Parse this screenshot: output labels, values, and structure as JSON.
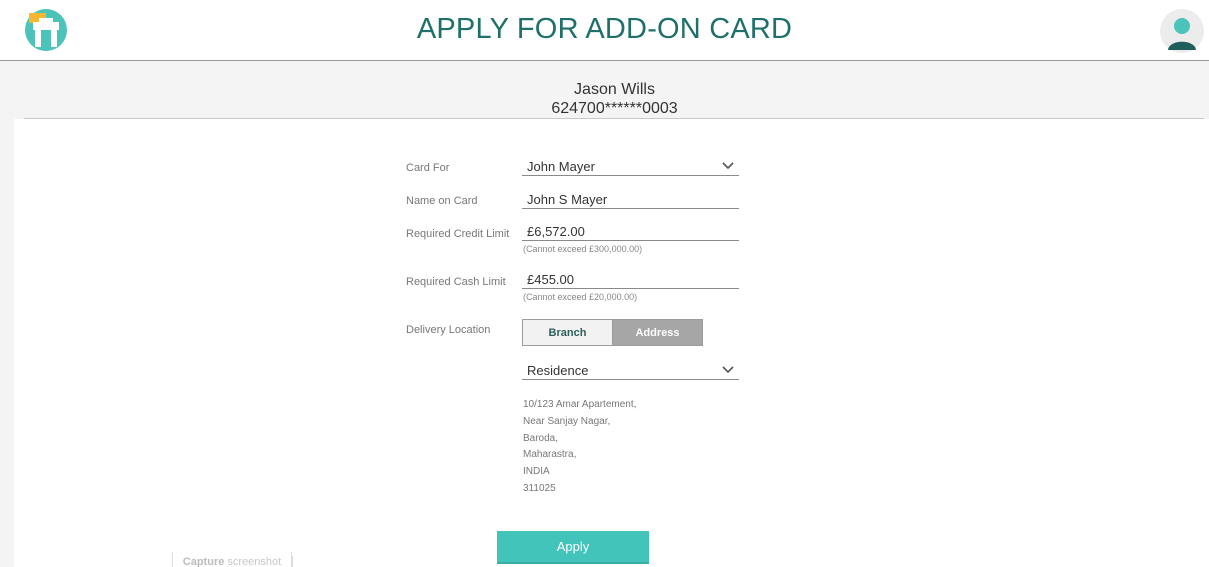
{
  "header": {
    "title": "APPLY FOR ADD-ON CARD",
    "logo_icon": "card-app-logo",
    "avatar_icon": "user-avatar"
  },
  "summary": {
    "card_holder": "Jason Wills",
    "card_number": "624700******0003"
  },
  "form": {
    "card_for": {
      "label": "Card For",
      "value": "John Mayer"
    },
    "name_on_card": {
      "label": "Name on Card",
      "value": "John S Mayer"
    },
    "credit_limit": {
      "label": "Required Credit Limit",
      "value": "£6,572.00",
      "hint": "(Cannot exceed £300,000.00)"
    },
    "cash_limit": {
      "label": "Required Cash Limit",
      "value": "£455.00",
      "hint": "(Cannot exceed £20,000.00)"
    },
    "delivery": {
      "label": "Delivery Location",
      "options": [
        "Branch",
        "Address"
      ],
      "selected": "Address",
      "address_type": "Residence",
      "address_lines": [
        "10/123 Amar Apartement,",
        "Near Sanjay Nagar,",
        "Baroda,",
        "Maharastra,",
        "INDIA",
        "311025"
      ]
    }
  },
  "actions": {
    "apply_label": "Apply"
  },
  "capture": {
    "label_bold": "Capture",
    "label_rest": " screenshot"
  },
  "colors": {
    "brand_teal": "#1f6f6b",
    "button_teal": "#43c4bb",
    "selected_segment": "#a6a6a6"
  }
}
